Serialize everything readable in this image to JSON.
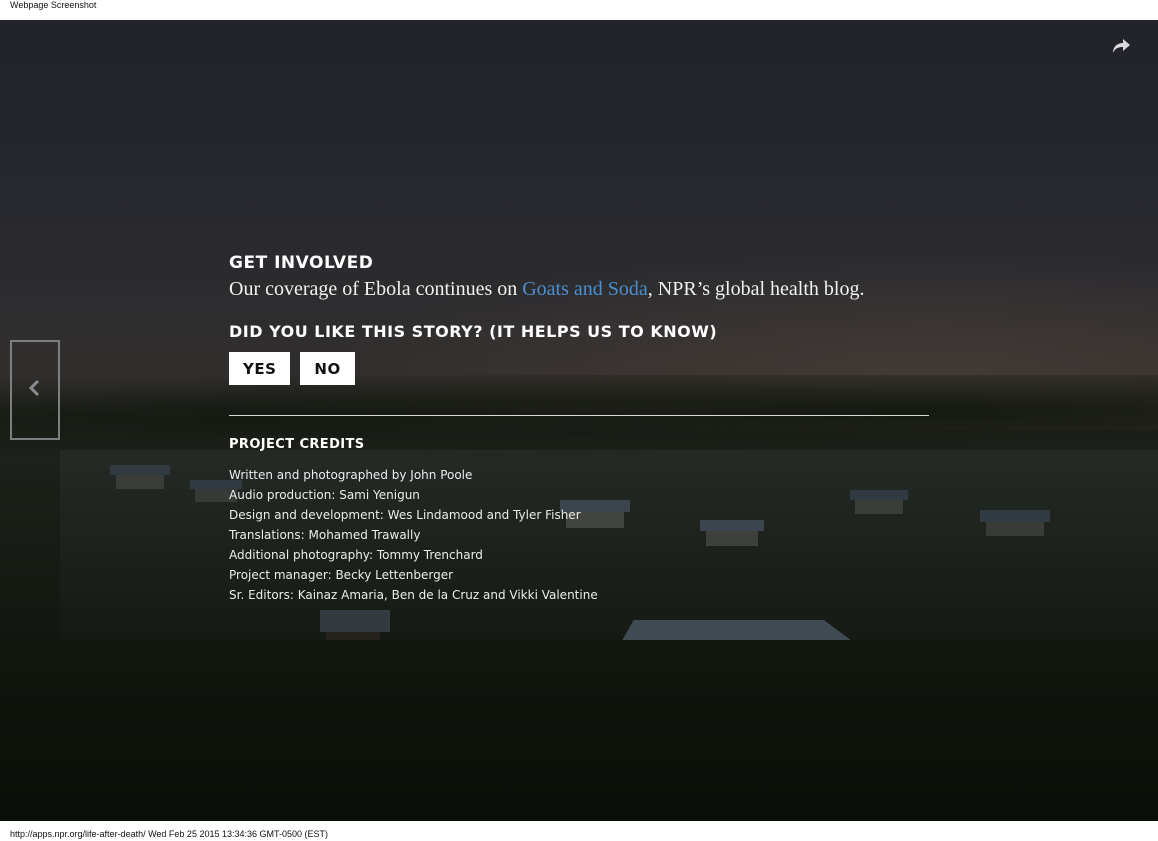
{
  "browser": {
    "header_title": "Webpage Screenshot",
    "footer_text": "http://apps.npr.org/life-after-death/ Wed Feb 25 2015 13:34:36 GMT-0500 (EST)"
  },
  "get_involved": {
    "heading": "GET INVOLVED",
    "text_before": "Our coverage of Ebola continues on ",
    "link_text": "Goats and Soda",
    "text_after": ", NPR’s global health blog.",
    "link_color": "#4a8fd0"
  },
  "feedback": {
    "heading": "DID YOU LIKE THIS STORY? (IT HELPS US TO KNOW)",
    "yes_label": "YES",
    "no_label": "NO"
  },
  "credits": {
    "heading": "PROJECT CREDITS",
    "items": [
      "Written and photographed by John Poole",
      "Audio production: Sami Yenigun",
      "Design and development: Wes Lindamood and Tyler Fisher",
      "Translations: Mohamed Trawally",
      "Additional photography: Tommy Trenchard",
      "Project manager: Becky Lettenberger",
      "Sr. Editors: Kainaz Amaria, Ben de la Cruz and Vikki Valentine"
    ]
  },
  "icons": {
    "share": "share-icon",
    "previous": "chevron-left-icon"
  }
}
